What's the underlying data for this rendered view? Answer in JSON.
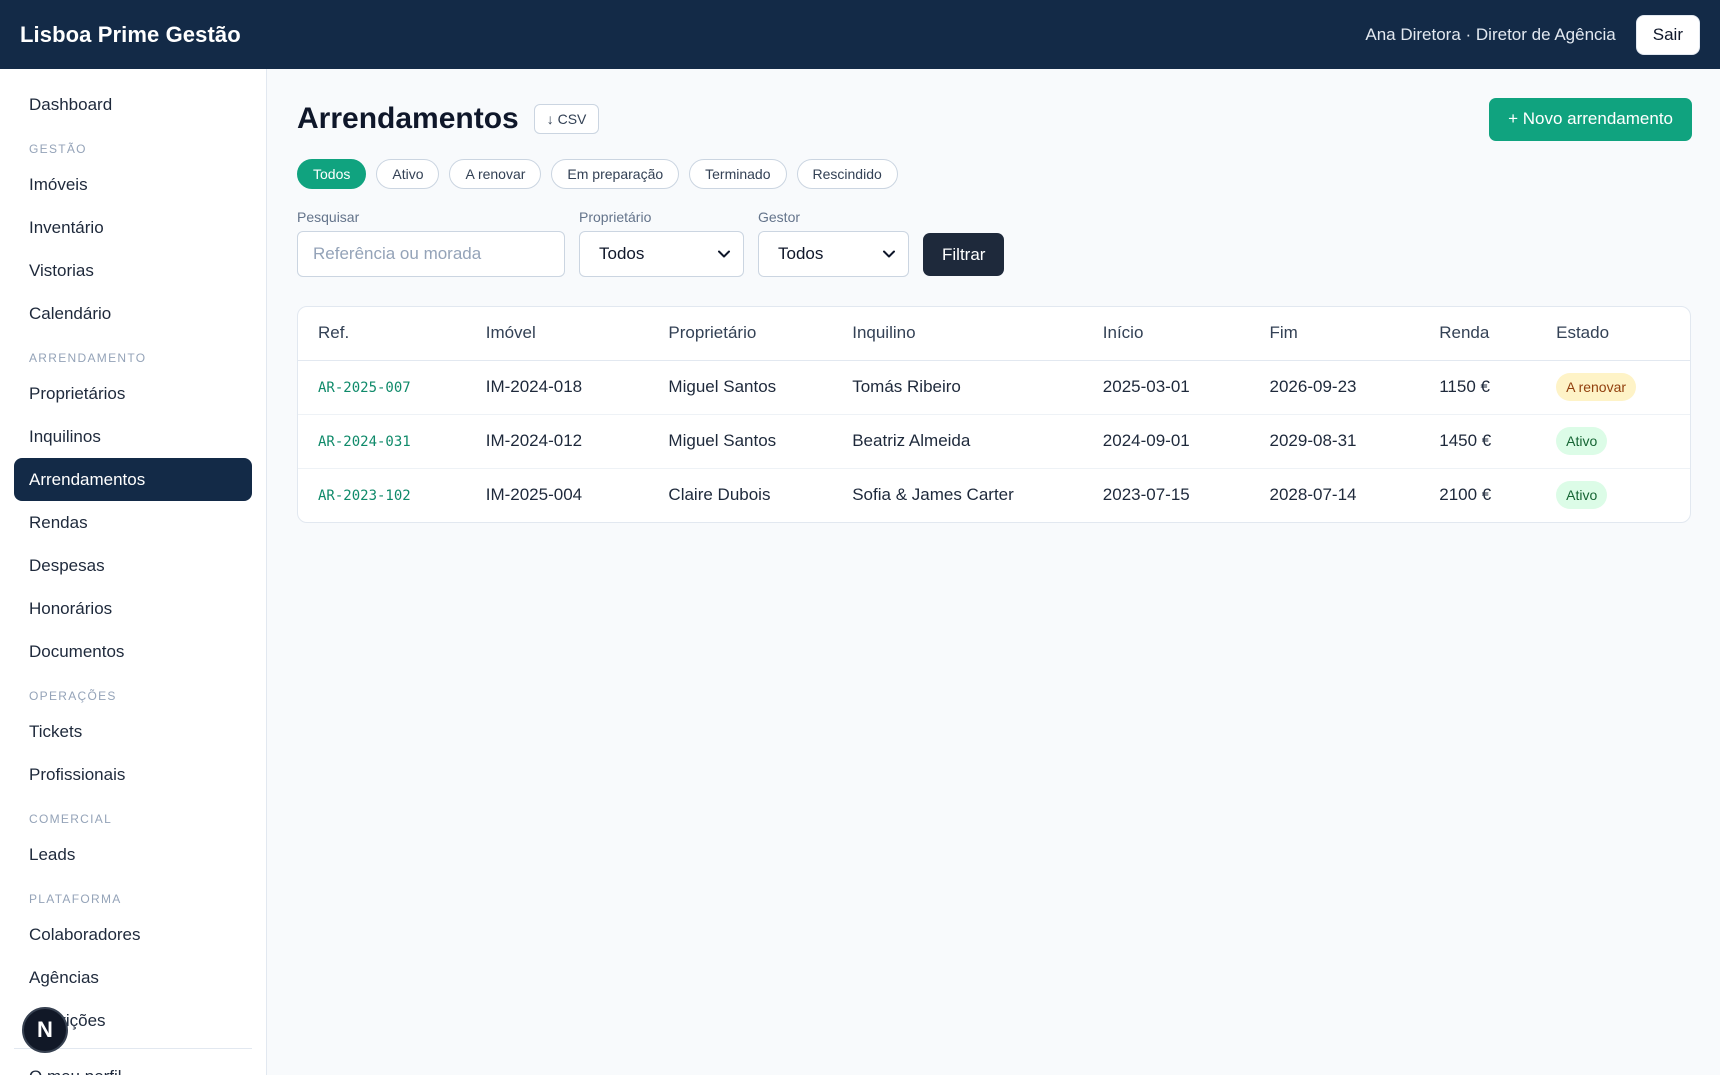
{
  "app": {
    "brand": "Lisboa Prime Gestão",
    "user_info": "Ana Diretora · Diretor de Agência",
    "logout_label": "Sair"
  },
  "sidebar": {
    "dashboard": "Dashboard",
    "sections": {
      "gestao": "GESTÃO",
      "arrendamento": "ARRENDAMENTO",
      "operacoes": "OPERAÇÕES",
      "comercial": "COMERCIAL",
      "plataforma": "PLATAFORMA"
    },
    "gestao_items": [
      "Imóveis",
      "Inventário",
      "Vistorias",
      "Calendário"
    ],
    "arrendamento_items": [
      "Proprietários",
      "Inquilinos",
      "Arrendamentos",
      "Rendas",
      "Despesas",
      "Honorários",
      "Documentos"
    ],
    "operacoes_items": [
      "Tickets",
      "Profissionais"
    ],
    "comercial_items": [
      "Leads"
    ],
    "plataforma_items": [
      "Colaboradores",
      "Agências",
      "Inscrições"
    ],
    "profile": "O meu perfil"
  },
  "fab": {
    "letter": "N"
  },
  "page": {
    "title": "Arrendamentos",
    "csv_label": "↓ CSV",
    "new_label": "+ Novo arrendamento",
    "chips": [
      "Todos",
      "Ativo",
      "A renovar",
      "Em preparação",
      "Terminado",
      "Rescindido"
    ],
    "filters": {
      "search_label": "Pesquisar",
      "search_placeholder": "Referência ou morada",
      "owner_label": "Proprietário",
      "owner_value": "Todos",
      "manager_label": "Gestor",
      "manager_value": "Todos",
      "filter_button": "Filtrar"
    }
  },
  "table": {
    "headers": [
      "Ref.",
      "Imóvel",
      "Proprietário",
      "Inquilino",
      "Início",
      "Fim",
      "Renda",
      "Estado"
    ],
    "rows": [
      {
        "ref": "AR-2025-007",
        "property": "IM-2024-018",
        "owner": "Miguel Santos",
        "tenant": "Tomás Ribeiro",
        "start": "2025-03-01",
        "end": "2026-09-23",
        "rent": "1150 €",
        "status": "A renovar"
      },
      {
        "ref": "AR-2024-031",
        "property": "IM-2024-012",
        "owner": "Miguel Santos",
        "tenant": "Beatriz Almeida",
        "start": "2024-09-01",
        "end": "2029-08-31",
        "rent": "1450 €",
        "status": "Ativo"
      },
      {
        "ref": "AR-2023-102",
        "property": "IM-2025-004",
        "owner": "Claire Dubois",
        "tenant": "Sofia & James Carter",
        "start": "2023-07-15",
        "end": "2028-07-14",
        "rent": "2100 €",
        "status": "Ativo"
      }
    ]
  },
  "colors": {
    "topbar": "#132a47",
    "accent": "#10a37f",
    "renovar_bg": "#fef3c7",
    "ativo_bg": "#dcfce7"
  }
}
